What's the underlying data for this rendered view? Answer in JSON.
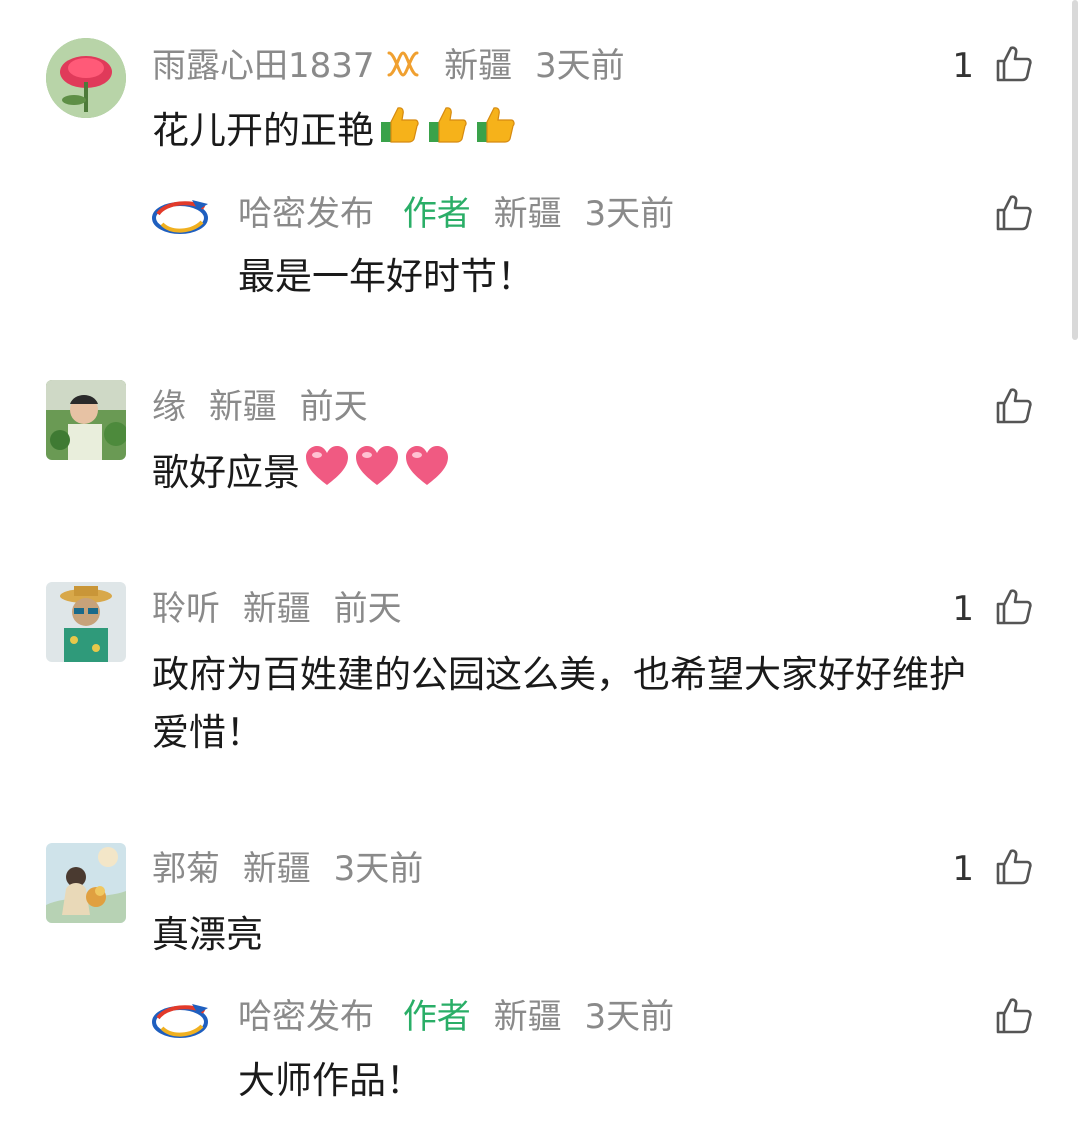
{
  "comments": [
    {
      "name": "雨露心田1837",
      "location": "新疆",
      "time": "3天前",
      "likes": "1",
      "text": "花儿开的正艳",
      "emoji": [
        "thumbs-up",
        "thumbs-up",
        "thumbs-up"
      ],
      "reply": {
        "name": "哈密发布",
        "author_tag": "作者",
        "location": "新疆",
        "time": "3天前",
        "text": "最是一年好时节！"
      }
    },
    {
      "name": "缘",
      "location": "新疆",
      "time": "前天",
      "text": "歌好应景",
      "emoji": [
        "heart",
        "heart",
        "heart"
      ]
    },
    {
      "name": "聆听",
      "location": "新疆",
      "time": "前天",
      "likes": "1",
      "text_line1": "政府为百姓建的公园这么美，也希望大家好好维护",
      "text_line2": "爱惜！"
    },
    {
      "name": "郭菊",
      "location": "新疆",
      "time": "3天前",
      "likes": "1",
      "text": "真漂亮",
      "reply": {
        "name": "哈密发布",
        "author_tag": "作者",
        "location": "新疆",
        "time": "3天前",
        "text": "大师作品！"
      }
    }
  ],
  "colors": {
    "author_tag": "#2aae67",
    "meta_text": "#8a8a8a",
    "body_text": "#1a1a1a",
    "badge": "#f0a030"
  },
  "icons": {
    "like": "thumbs-up-outline-icon",
    "badge": "infinity-badge-icon"
  }
}
